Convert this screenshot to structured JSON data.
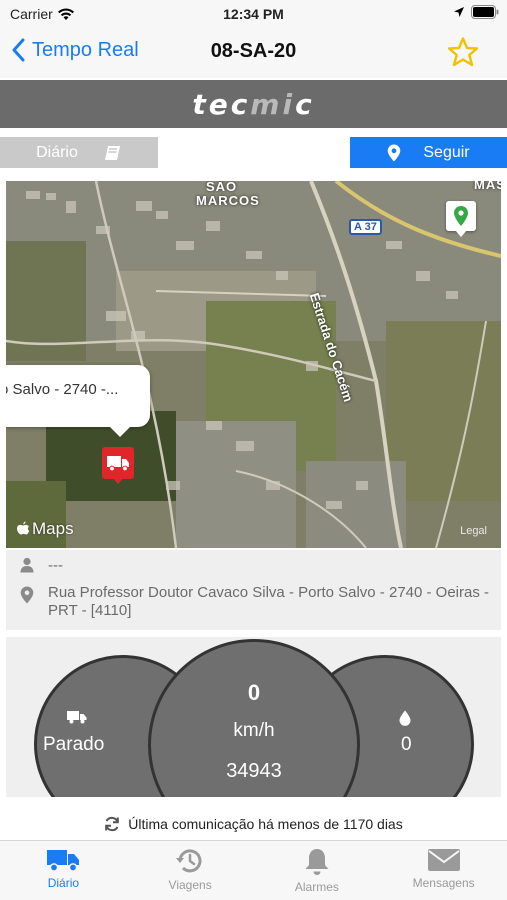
{
  "status_bar": {
    "carrier": "Carrier",
    "time": "12:34 PM"
  },
  "nav": {
    "back_label": "Tempo Real",
    "title": "08-SA-20",
    "favorite_icon": "star-outline-icon"
  },
  "brand": {
    "logo_prefix": "tec",
    "logo_mid": "mi",
    "logo_suffix": "c"
  },
  "toolbar": {
    "diario_label": "Diário",
    "seguir_label": "Seguir"
  },
  "map": {
    "callout_text": "o Salvo - 2740 -...",
    "place_label": "SÃO MARCOS",
    "place_label_line1": "SÃO",
    "place_label_line2": "MARCOS",
    "edge_label": "MAS",
    "road_shield": "A 37",
    "road_name": "Estrada do Cacém",
    "attribution": "Maps",
    "legal": "Legal"
  },
  "info": {
    "driver": "---",
    "address": "Rua Professor Doutor Cavaco Silva - Porto Salvo - 2740 - Oeiras - PRT - [4110]"
  },
  "gauges": {
    "state_label": "Parado",
    "speed_value": "0",
    "speed_unit": "km/h",
    "odometer": "34943",
    "fuel_value": "0"
  },
  "last_communication": "Última comunicação há menos de 1170 dias",
  "tabs": [
    {
      "label": "Diário",
      "icon": "truck-icon",
      "active": true
    },
    {
      "label": "Viagens",
      "icon": "history-icon",
      "active": false
    },
    {
      "label": "Alarmes",
      "icon": "bell-icon",
      "active": false
    },
    {
      "label": "Mensagens",
      "icon": "envelope-icon",
      "active": false
    }
  ],
  "colors": {
    "accent": "#1a7cf5",
    "brand_bar": "#6b6b6b",
    "alert_pin": "#e0262b",
    "gauge_fill": "#6f6f6f"
  }
}
